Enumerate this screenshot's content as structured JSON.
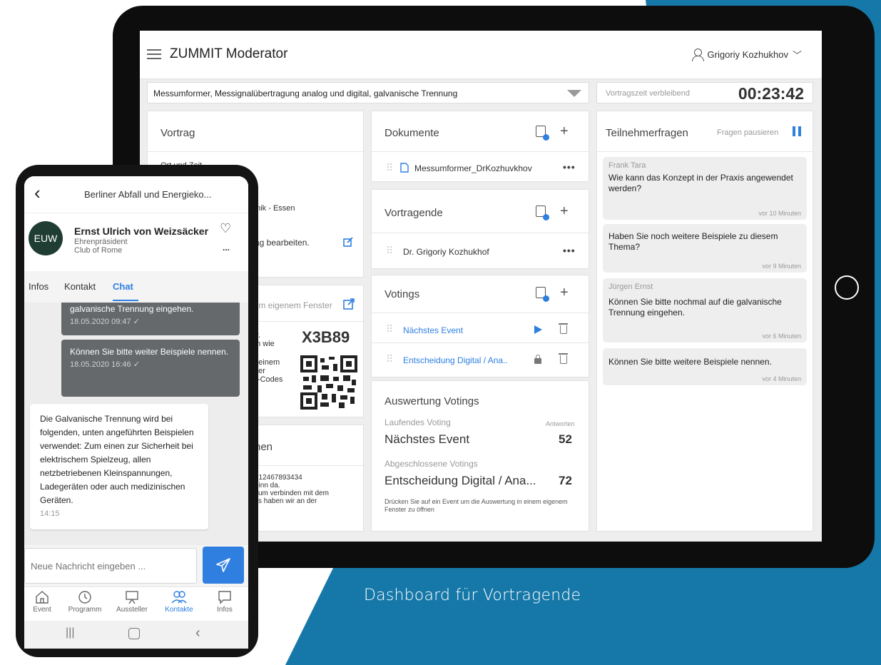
{
  "colors": {
    "accent": "#2f7fe0",
    "brand_blue": "#1678a8",
    "dark_bubble": "#65696b",
    "avatar_bg": "#1f3d33"
  },
  "caption": "Dashboard für Vortragende",
  "tablet": {
    "app_title": "ZUMMIT Moderator",
    "user_name": "Grigoriy Kozhukhov",
    "topic": "Messumformer, Messignalübertragung analog und digital, galvanische Trennung",
    "timer_label": "Vortragszeit verbleibend",
    "timer_value": "00:23:42",
    "vortrag": {
      "title": "Vortrag",
      "partial_top": "Ort und Zeit",
      "partial_location": "hnik - Essen",
      "edit_link": "rag bearbeiten."
    },
    "window_card": {
      "link": "Im eigenem Fenster",
      "code": "X3B89",
      "partial_lines": [
        "r.",
        "en wie",
        "",
        "n einem",
        "mer",
        "R-Codes"
      ]
    },
    "bottom_left": {
      "title": "hen",
      "partial_lines": [
        ": 12467893434",
        "ginn da.",
        "zum verbinden mit dem",
        "cs haben wir an der"
      ]
    },
    "dokumente": {
      "title": "Dokumente",
      "item": "Messumformer_DrKozhuvkhov"
    },
    "vortragende": {
      "title": "Vortragende",
      "item": "Dr. Grigoriy Kozhukhof"
    },
    "votings": {
      "title": "Votings",
      "items": [
        "Nächstes Event",
        "Entscheidung Digital / Ana.."
      ]
    },
    "auswertung": {
      "title": "Auswertung Votings",
      "running_label": "Laufendes Voting",
      "answers_label": "Antworten",
      "running_name": "Nächstes Event",
      "running_count": "52",
      "closed_label": "Abgeschlossene Votings",
      "closed_name": "Entscheidung Digital / Ana...",
      "closed_count": "72",
      "hint": "Drücken Sie auf ein Event um die Auswertung in einem eigenem Fenster zu öffnen"
    },
    "questions": {
      "title": "Teilnehmerfragen",
      "pause": "Fragen pausieren",
      "items": [
        {
          "author": "Frank Tara",
          "text": "Wie kann das Konzept in der Praxis angewendet werden?",
          "time": "vor 10 Minuten"
        },
        {
          "author": "",
          "text": "Haben Sie noch weitere Beispiele zu diesem Thema?",
          "time": "vor 9 Minuten"
        },
        {
          "author": "Jürgen Ernst",
          "text": "Können Sie bitte nochmal auf die galvanische Trennung eingehen.",
          "time": "vor 6 Minuten"
        },
        {
          "author": "",
          "text": "Können Sie bitte weitere Beispiele nennen.",
          "time": "vor 4 Minuten"
        }
      ]
    }
  },
  "phone": {
    "header_title": "Berliner Abfall und Energieko...",
    "avatar_initials": "EUW",
    "name": "Ernst Ulrich von Weizsäcker",
    "role": "Ehrenpräsident",
    "org": "Club of Rome",
    "tabs": [
      "Infos",
      "Kontakt",
      "Chat"
    ],
    "messages": [
      {
        "text": "galvanische Trennung eingehen.",
        "time": "18.05.2020 09:47"
      },
      {
        "text": "Können Sie bitte weiter Beispiele nennen.",
        "time": "18.05.2020 16:46"
      },
      {
        "text": "Die Galvanische Trennung wird bei folgenden, unten angeführten Beispielen verwendet: Zum einen zur Sicherheit bei elektrischem Spielzeug, allen netzbetriebenen Kleinspannungen, Ladegeräten oder auch medizinischen Geräten.",
        "time": "14:15"
      }
    ],
    "input_placeholder": "Neue Nachricht eingeben ...",
    "nav": [
      "Event",
      "Programm",
      "Aussteller",
      "Kontakte",
      "Infos"
    ]
  }
}
